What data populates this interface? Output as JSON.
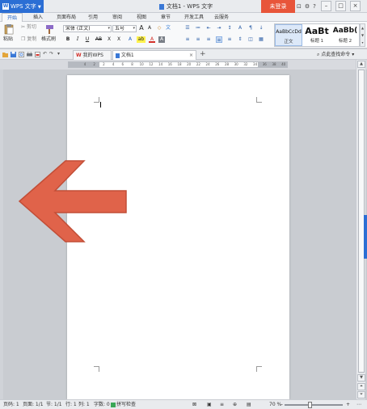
{
  "title_bar": {
    "app_button": "WPS 文字",
    "doc_title": "文档1 - WPS 文字",
    "login": "未登录",
    "help": "?",
    "win_min": "–",
    "win_max": "□",
    "win_close": "×"
  },
  "tabs": [
    "开始",
    "插入",
    "页面布局",
    "引用",
    "审阅",
    "视图",
    "章节",
    "开发工具",
    "云服务"
  ],
  "ribbon": {
    "paste": "粘贴",
    "cut": "剪切",
    "copy": "复制",
    "format_painter": "格式刷",
    "font_name": "宋体 (正文)",
    "font_size": "五号",
    "grow_font": "A",
    "shrink_font": "A",
    "clear_format": "◇",
    "bold": "B",
    "italic": "I",
    "underline": "U",
    "strike": "AB",
    "superscript": "X",
    "subscript": "X",
    "font_color": "A",
    "highlight": "ab",
    "styles": [
      {
        "preview": "AaBbCcDd",
        "name": "正文"
      },
      {
        "preview": "AaBt",
        "name": "标题 1"
      },
      {
        "preview": "AaBb(",
        "name": "标题 2"
      }
    ]
  },
  "doc_tabs": {
    "my_wps": "我的WPS",
    "doc1": "文档1",
    "close": "×",
    "new_tab": "+",
    "find": "点此查找命令"
  },
  "ruler_numbers": [
    "4",
    "2",
    "2",
    "4",
    "6",
    "8",
    "10",
    "12",
    "14",
    "16",
    "18",
    "20",
    "22",
    "24",
    "26",
    "28",
    "30",
    "32",
    "34",
    "36",
    "38",
    "40"
  ],
  "status_bar": {
    "page": "页码: 1",
    "pages": "页面: 1/1",
    "section": "节: 1/1",
    "line": "行: 1",
    "column": "列: 1",
    "words": "字数: 0",
    "spell_check": "拼写检查",
    "zoom": "70 %",
    "zoom_out": "–",
    "zoom_in": "+"
  },
  "colors": {
    "accent": "#2b6ed4",
    "login": "#e8553a",
    "arrow": "#e0634a"
  }
}
